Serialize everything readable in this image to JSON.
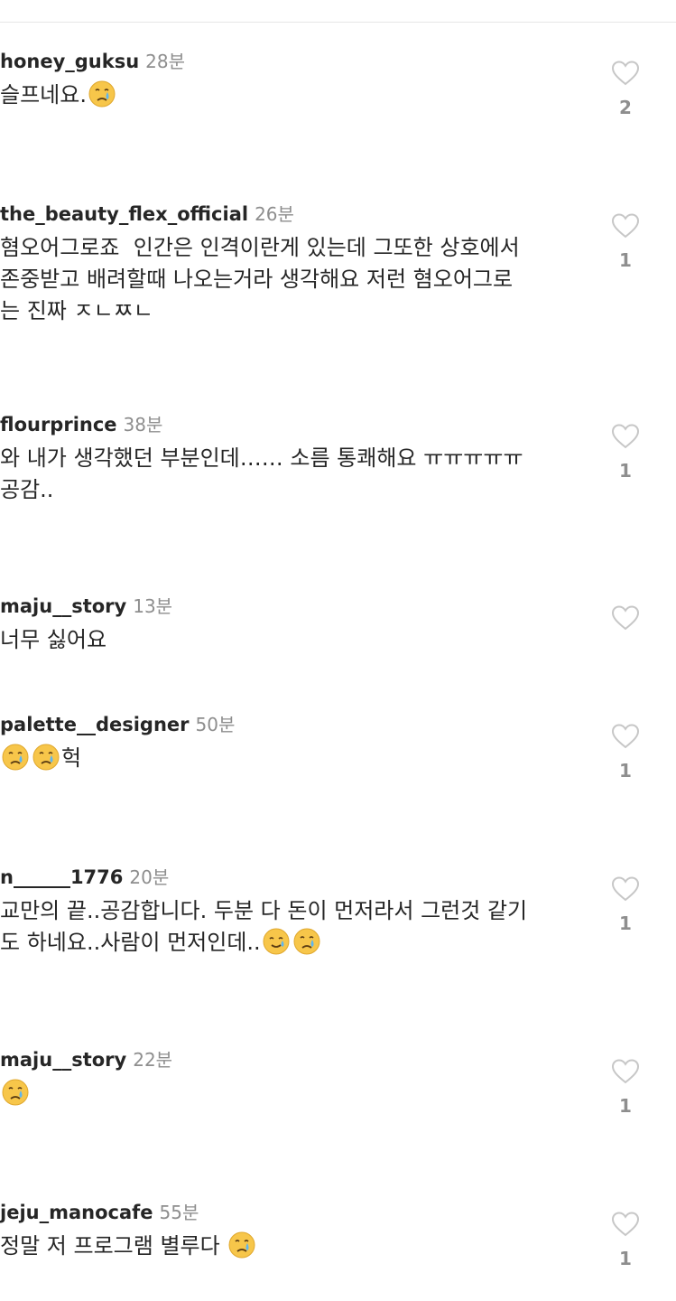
{
  "comments": [
    {
      "username": "honey_guksu",
      "time": "28분",
      "text": "슬프네요.",
      "emojis": [
        "crying-face"
      ],
      "likes": "2"
    },
    {
      "username": "the_beauty_flex_official",
      "time": "26분",
      "text": "혐오어그로죠  인간은 인격이란게 있는데 그또한 상호에서\n존중받고 배려할때 나오는거라 생각해요 저런 혐오어그로\n는 진짜 ㅈㄴㅉㄴ",
      "emojis": [],
      "likes": "1"
    },
    {
      "username": "flourprince",
      "time": "38분",
      "text": "와 내가 생각했던 부분인데…… 소름 통쾌해요 ㅠㅠㅠㅠㅠ\n공감..",
      "emojis": [],
      "likes": "1"
    },
    {
      "username": "maju__story",
      "time": "13분",
      "text": "너무 싫어요",
      "emojis": [],
      "likes": ""
    },
    {
      "username": "palette__designer",
      "time": "50분",
      "text": "헉",
      "emojis_before": [
        "crying-face",
        "crying-face"
      ],
      "likes": "1"
    },
    {
      "username": "n______1776",
      "time": "20분",
      "text": "교만의 끝..공감합니다. 두분 다 돈이 먼저라서 그런것 같기\n도 하네요..사람이 먼저인데..",
      "emojis": [
        "smiling-face-with-tear",
        "crying-face"
      ],
      "likes": "1"
    },
    {
      "username": "maju__story",
      "time": "22분",
      "text": "",
      "emojis": [
        "crying-face"
      ],
      "likes": "1"
    },
    {
      "username": "jeju_manocafe",
      "time": "55분",
      "text": "정말 저 프로그램 별루다 ",
      "emojis": [
        "crying-face"
      ],
      "likes": "1"
    }
  ],
  "icons": {
    "like": "heart-outline-icon"
  },
  "colors": {
    "text": "#262626",
    "secondary": "#8e8e8e",
    "emoji_face": "#f7c64a"
  }
}
